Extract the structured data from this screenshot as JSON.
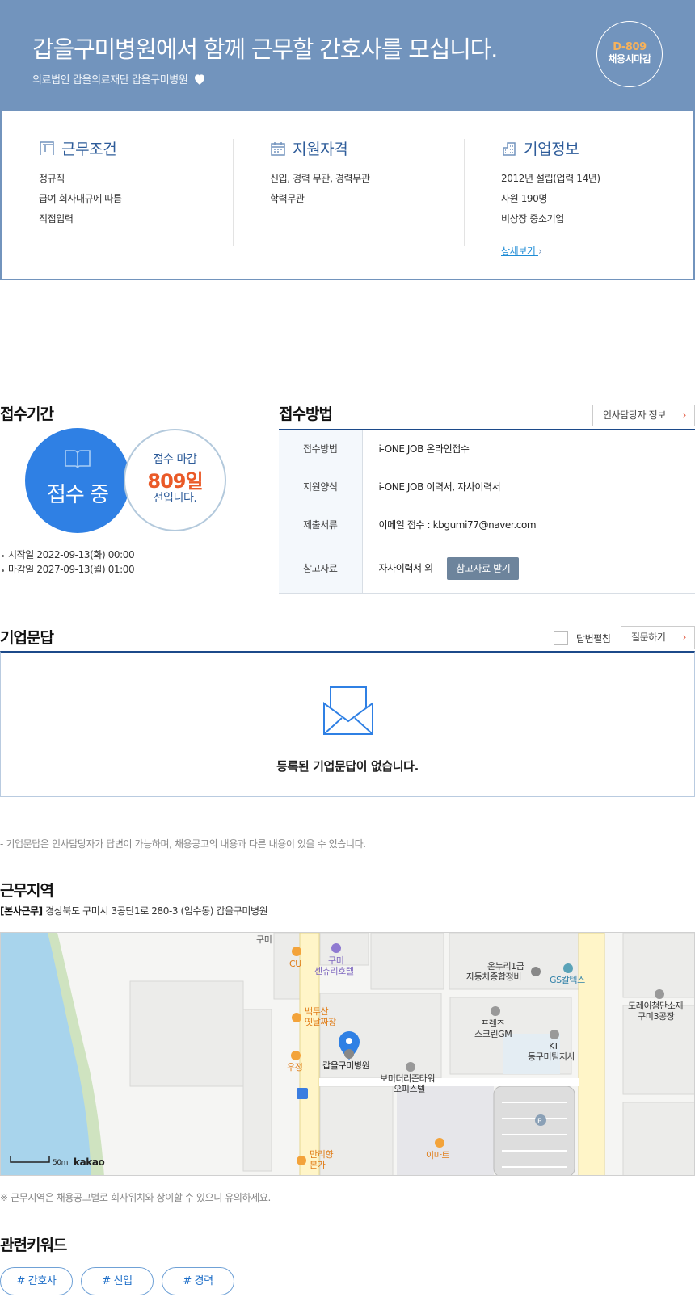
{
  "header": {
    "title": "갑을구미병원에서 함께 근무할 간호사를 모십니다.",
    "subtitle": "의료법인 갑을의료재단 갑을구미병원",
    "dday": "D-809",
    "dday_label": "채용시마감"
  },
  "info": {
    "work": {
      "title": "근무조건",
      "rows": [
        "정규직",
        "급여 회사내규에 따름",
        "직접입력"
      ]
    },
    "qual": {
      "title": "지원자격",
      "rows": [
        "신입, 경력 무관, 경력무관",
        "학력무관"
      ]
    },
    "company": {
      "title": "기업정보",
      "rows": [
        "2012년 설립(업력 14년)",
        "사원 190명",
        "비상장 중소기업"
      ],
      "more": "상세보기"
    }
  },
  "period": {
    "title": "접수기간",
    "status": "접수 중",
    "deadline_l1": "접수 마감",
    "deadline_days": "809일",
    "deadline_l3": "전입니다.",
    "start": "시작일 2022-09-13(화) 00:00",
    "end": "마감일 2027-09-13(월) 01:00"
  },
  "apply": {
    "title": "접수방법",
    "hr_button": "인사담당자 정보",
    "rows": [
      {
        "k": "접수방법",
        "v": "i-ONE JOB 온라인접수"
      },
      {
        "k": "지원양식",
        "v": "i-ONE JOB 이력서, 자사이력서"
      },
      {
        "k": "제출서류",
        "v": "이메일 접수 : kbgumi77@naver.com"
      },
      {
        "k": "참고자료",
        "v": "자사이력서 외"
      }
    ],
    "ref_button": "참고자료 받기"
  },
  "qa": {
    "title": "기업문답",
    "expand_label": "답변펼침",
    "ask_button": "질문하기",
    "empty": "등록된 기업문답이 없습니다.",
    "note": "- 기업문답은 인사담당자가 답변이 가능하며, 채용공고의 내용과 다른 내용이 있을 수 있습니다."
  },
  "location": {
    "title": "근무지역",
    "tag": "[본사근무]",
    "address": "경상북도 구미시 3공단1로 280-3 (임수동) 갑을구미병원",
    "note": "※ 근무지역은 채용공고별로 회사위치와 상이할 수 있으니 유의하세요.",
    "map": {
      "labels": {
        "gumi": "구미",
        "cu": "CU",
        "century1": "구미",
        "century2": "센츄리호텔",
        "onnuri1": "온누리1급",
        "onnuri2": "자동차종합정비",
        "gs": "GS칼텍스",
        "dorei1": "도레이첨단소재",
        "dorei2": "구미3공장",
        "baekdu1": "백두산",
        "baekdu2": "옛날짜장",
        "friends1": "프렌즈",
        "friends2": "스크린GM",
        "kt1": "KT",
        "kt2": "동구미팀지사",
        "woojeong": "우정",
        "hospital": "갑을구미병원",
        "bomi1": "보미더리즌타워",
        "bomi2": "오피스텔",
        "emart": "이마트",
        "malli1": "만리향",
        "malli2": "본가",
        "scale": "50m",
        "brand": "kakao"
      }
    }
  },
  "keywords": {
    "title": "관련키워드",
    "items": [
      "# 간호사",
      "# 신입",
      "# 경력"
    ]
  },
  "colors": {
    "hero": "#7294bd",
    "accent_blue": "#2f80e4",
    "deadline": "#ea5a28",
    "navy": "#1c4a8a"
  }
}
